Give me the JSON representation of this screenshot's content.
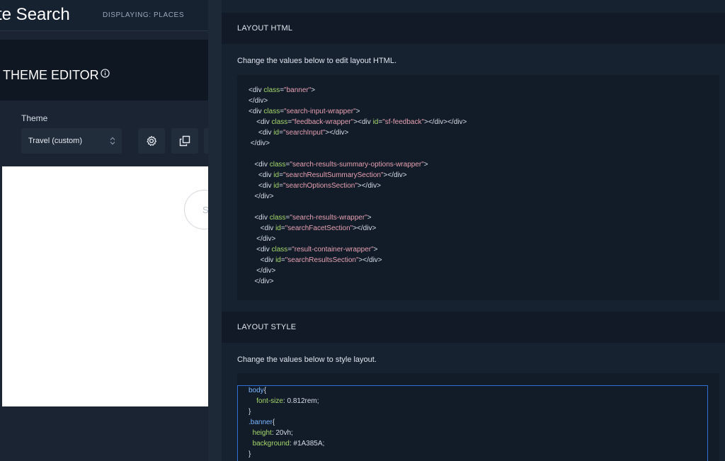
{
  "header": {
    "app_title": "te Search",
    "display_label": "DISPLAYING: PLACES"
  },
  "editor": {
    "title": "THEME EDITOR",
    "theme_label": "Theme",
    "theme_value": "Travel (custom)"
  },
  "icons": {
    "info": "info-icon",
    "select_arrows": "select-arrows-icon",
    "settings": "gear-icon",
    "duplicate": "copy-icon"
  },
  "preview": {
    "circle_text": "S"
  },
  "layout_html": {
    "title": "LAYOUT HTML",
    "help": "Change the values below to edit layout HTML."
  },
  "layout_style": {
    "title": "LAYOUT STYLE",
    "help": "Change the values below to style layout."
  },
  "colors": {
    "accent": "#2f6fd6",
    "attr": "#a6d86a",
    "string": "#e6a0b0",
    "selector": "#7ab6ff"
  }
}
